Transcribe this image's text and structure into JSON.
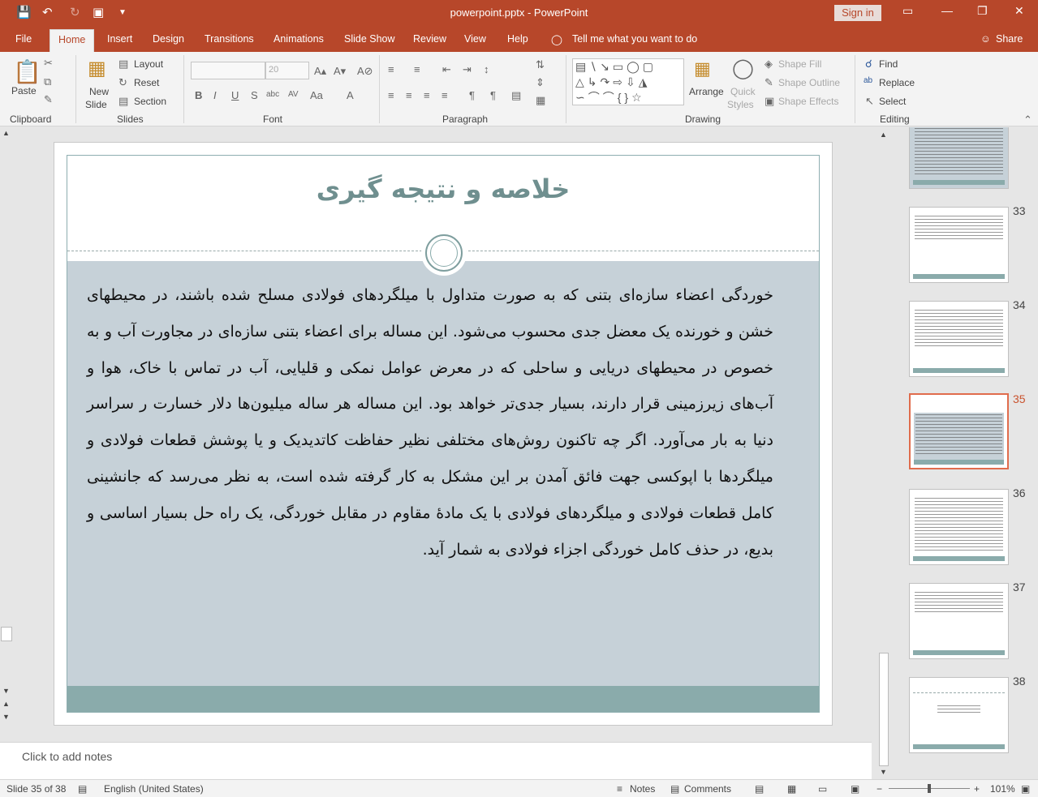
{
  "titlebar": {
    "title": "powerpoint.pptx  -  PowerPoint",
    "signin": "Sign in",
    "save_icon": "save-icon",
    "undo_icon": "undo-icon"
  },
  "tabs": {
    "file": "File",
    "home": "Home",
    "insert": "Insert",
    "design": "Design",
    "transitions": "Transitions",
    "animations": "Animations",
    "slideshow": "Slide Show",
    "review": "Review",
    "view": "View",
    "help": "Help",
    "tellme": "Tell me what you want to do",
    "share": "Share"
  },
  "ribbon": {
    "paste": "Paste",
    "clipboard": "Clipboard",
    "new_slide_1": "New",
    "new_slide_2": "Slide",
    "layout": "Layout",
    "reset": "Reset",
    "section": "Section",
    "slides": "Slides",
    "font_size": "20",
    "font": "Font",
    "paragraph": "Paragraph",
    "arrange": "Arrange",
    "quick_styles_1": "Quick",
    "quick_styles_2": "Styles",
    "shape_fill": "Shape Fill",
    "shape_outline": "Shape Outline",
    "shape_effects": "Shape Effects",
    "drawing": "Drawing",
    "find": "Find",
    "replace": "Replace",
    "select": "Select",
    "editing": "Editing"
  },
  "slide": {
    "title": "خلاصه و نتیجه گیری",
    "body": "خوردگی اعضاء سازه‌ای بتنی که به صورت متداول با میلگردهای فولادی مسلح شده باشند، در محیطهای خشن و خورنده یک معضل جدی محسوب می‌شود. این مساله برای اعضاء بتنی سازه‌ای در مجاورت آب و به خصوص در محیطهای دریایی و ساحلی که در معرض عوامل نمکی و قلیایی، آب در تماس با خاک، هوا و آب‌های زیرزمینی قرار دارند، بسیار جدی‌تر خواهد بود. این مساله هر ساله میلیون‌ها دلار خسارت ر سراسر دنیا به بار می‌آورد. اگر چه تاکنون روش‌های مختلفی نظیر حفاظت کاتدیدیک و یا پوشش قطعات فولادی و میلگردها با اپوکسی جهت فائق آمدن بر این مشکل به کار گرفته شده است، به نظر می‌رسد که جانشینی کامل قطعات فولادی و میلگردهای فولادی با یک مادهٔ  مقاوم در مقابل خوردگی، یک راه حل بسیار اساسی و بدیع، در حذف کامل خوردگی اجزاء فولادی به شمار آید."
  },
  "notes": {
    "placeholder": "Click to add notes"
  },
  "thumbnails": [
    {
      "num": "33"
    },
    {
      "num": "34"
    },
    {
      "num": "35"
    },
    {
      "num": "36"
    },
    {
      "num": "37"
    },
    {
      "num": "38"
    }
  ],
  "status": {
    "slide": "Slide 35 of 38",
    "language": "English (United States)",
    "notes": "Notes",
    "comments": "Comments",
    "zoom": "101%"
  }
}
